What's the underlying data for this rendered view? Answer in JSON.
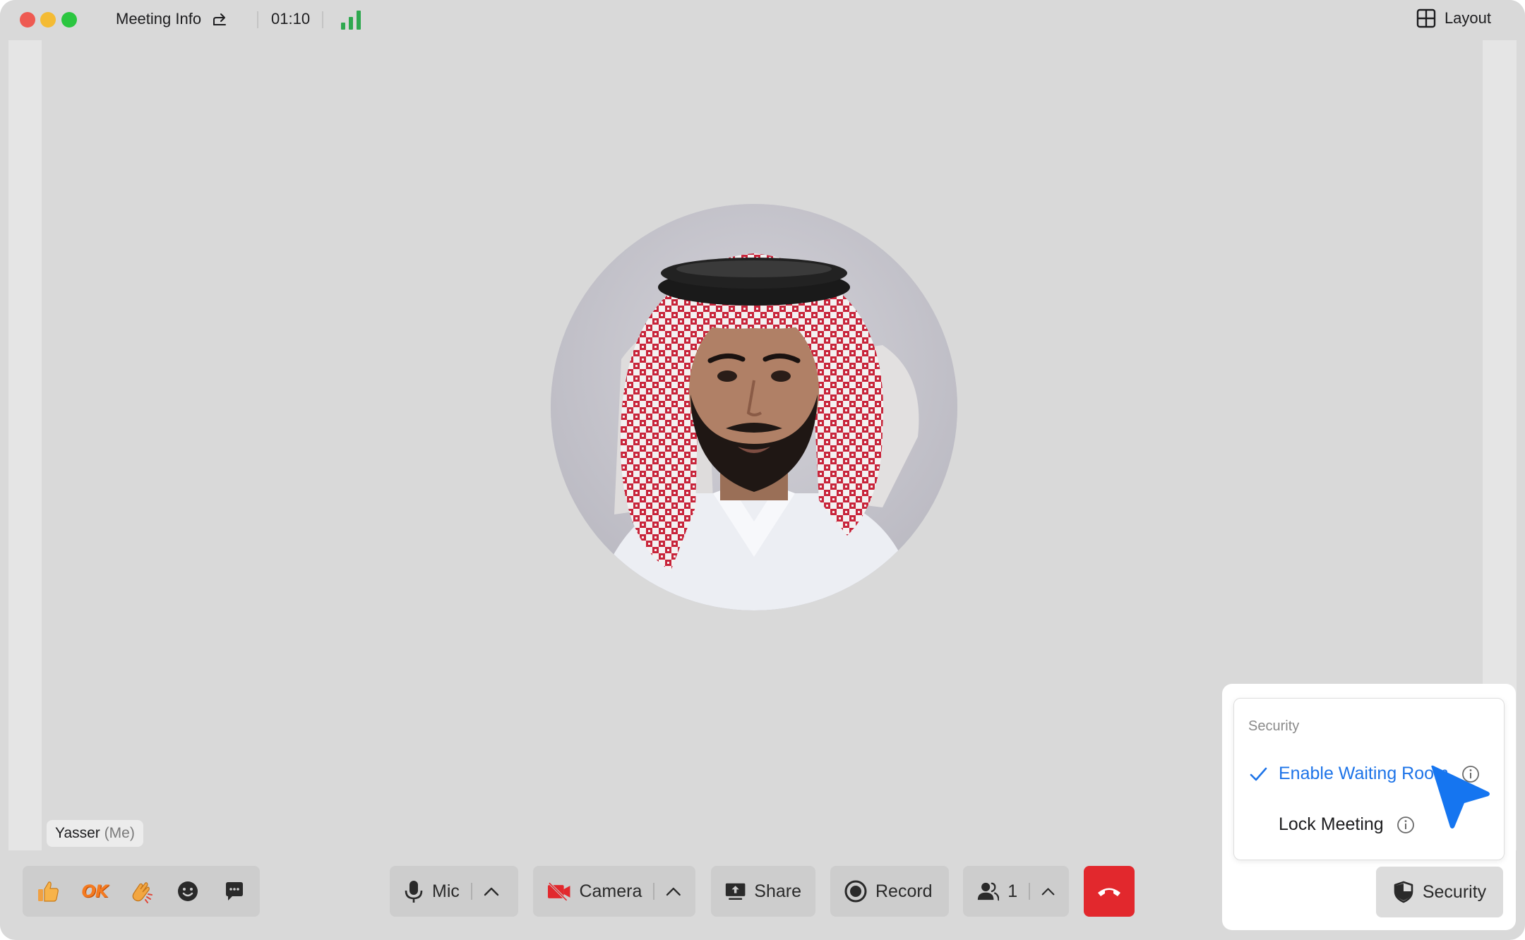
{
  "titlebar": {
    "meeting_info_label": "Meeting Info",
    "timer": "01:10",
    "layout_label": "Layout"
  },
  "participant": {
    "name": "Yasser",
    "self_suffix": "(Me)"
  },
  "reactions": {
    "ok_label": "OK",
    "items": [
      "thumbs-up-icon",
      "ok-icon",
      "clap-icon",
      "emoji-icon",
      "chat-icon"
    ]
  },
  "toolbar": {
    "mic_label": "Mic",
    "camera_label": "Camera",
    "share_label": "Share",
    "record_label": "Record",
    "participants_count": "1",
    "security_label": "Security"
  },
  "security_menu": {
    "title": "Security",
    "items": [
      {
        "label": "Enable Waiting Room",
        "checked": true
      },
      {
        "label": "Lock Meeting",
        "checked": false
      }
    ]
  },
  "colors": {
    "accent": "#1e74e8",
    "signal": "#2ea84f",
    "end_call": "#e2282d",
    "camera_off": "#e2282d"
  }
}
